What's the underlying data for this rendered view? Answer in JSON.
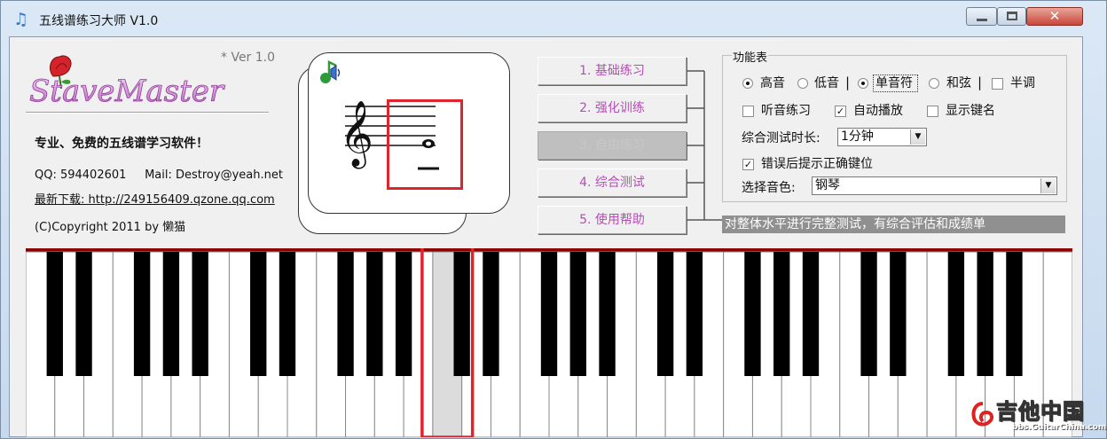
{
  "window": {
    "title": "五线谱练习大师 V1.0",
    "controls": {
      "minimize": "–",
      "maximize": "□",
      "close": "✕"
    }
  },
  "header": {
    "logo_text": "StaveMaster",
    "version": "* Ver 1.0",
    "tagline": "专业、免费的五线谱学习软件！",
    "contact": "QQ: 594402601     Mail: Destroy@yeah.net",
    "download": "最新下载: http://249156409.qzone.qq.com",
    "copyright": "(C)Copyright 2011 by  懒猫"
  },
  "menu": [
    {
      "label": "1. 基础练习",
      "active": false
    },
    {
      "label": "2. 强化训练",
      "active": false
    },
    {
      "label": "3. 自由练习",
      "active": true
    },
    {
      "label": "4. 综合测试",
      "active": false
    },
    {
      "label": "5. 使用帮助",
      "active": false
    }
  ],
  "functions": {
    "legend": "功能表",
    "clef_options": [
      {
        "label": "高音",
        "checked": true
      },
      {
        "label": "低音",
        "checked": false
      }
    ],
    "note_options": [
      {
        "label": "单音符",
        "checked": true
      },
      {
        "label": "和弦",
        "checked": false
      }
    ],
    "semitone": {
      "label": "半调",
      "checked": false
    },
    "ear_training": {
      "label": "听音练习",
      "checked": false
    },
    "auto_play": {
      "label": "自动播放",
      "checked": true
    },
    "show_keys": {
      "label": "显示键名",
      "checked": false
    },
    "test_duration": {
      "label": "综合测试时长:",
      "value": "1分钟"
    },
    "hint_on_error": {
      "label": "错误后提示正确键位",
      "checked": true
    },
    "timbre": {
      "label": "选择音色:",
      "value": "钢琴"
    }
  },
  "status_text": "对整体水平进行完整测试，有综合评估和成绩单",
  "piano": {
    "white_key_count": 36,
    "highlighted_white_key": 14,
    "black_key_count": 25
  },
  "watermark": {
    "text": "吉他中国",
    "url": "bbs.GuitarChina.com"
  },
  "colors": {
    "menu_text": "#b54db5",
    "piano_rail": "#8b0000",
    "highlight_box": "#e0242c",
    "pressed_key": "#dcdcdc"
  }
}
